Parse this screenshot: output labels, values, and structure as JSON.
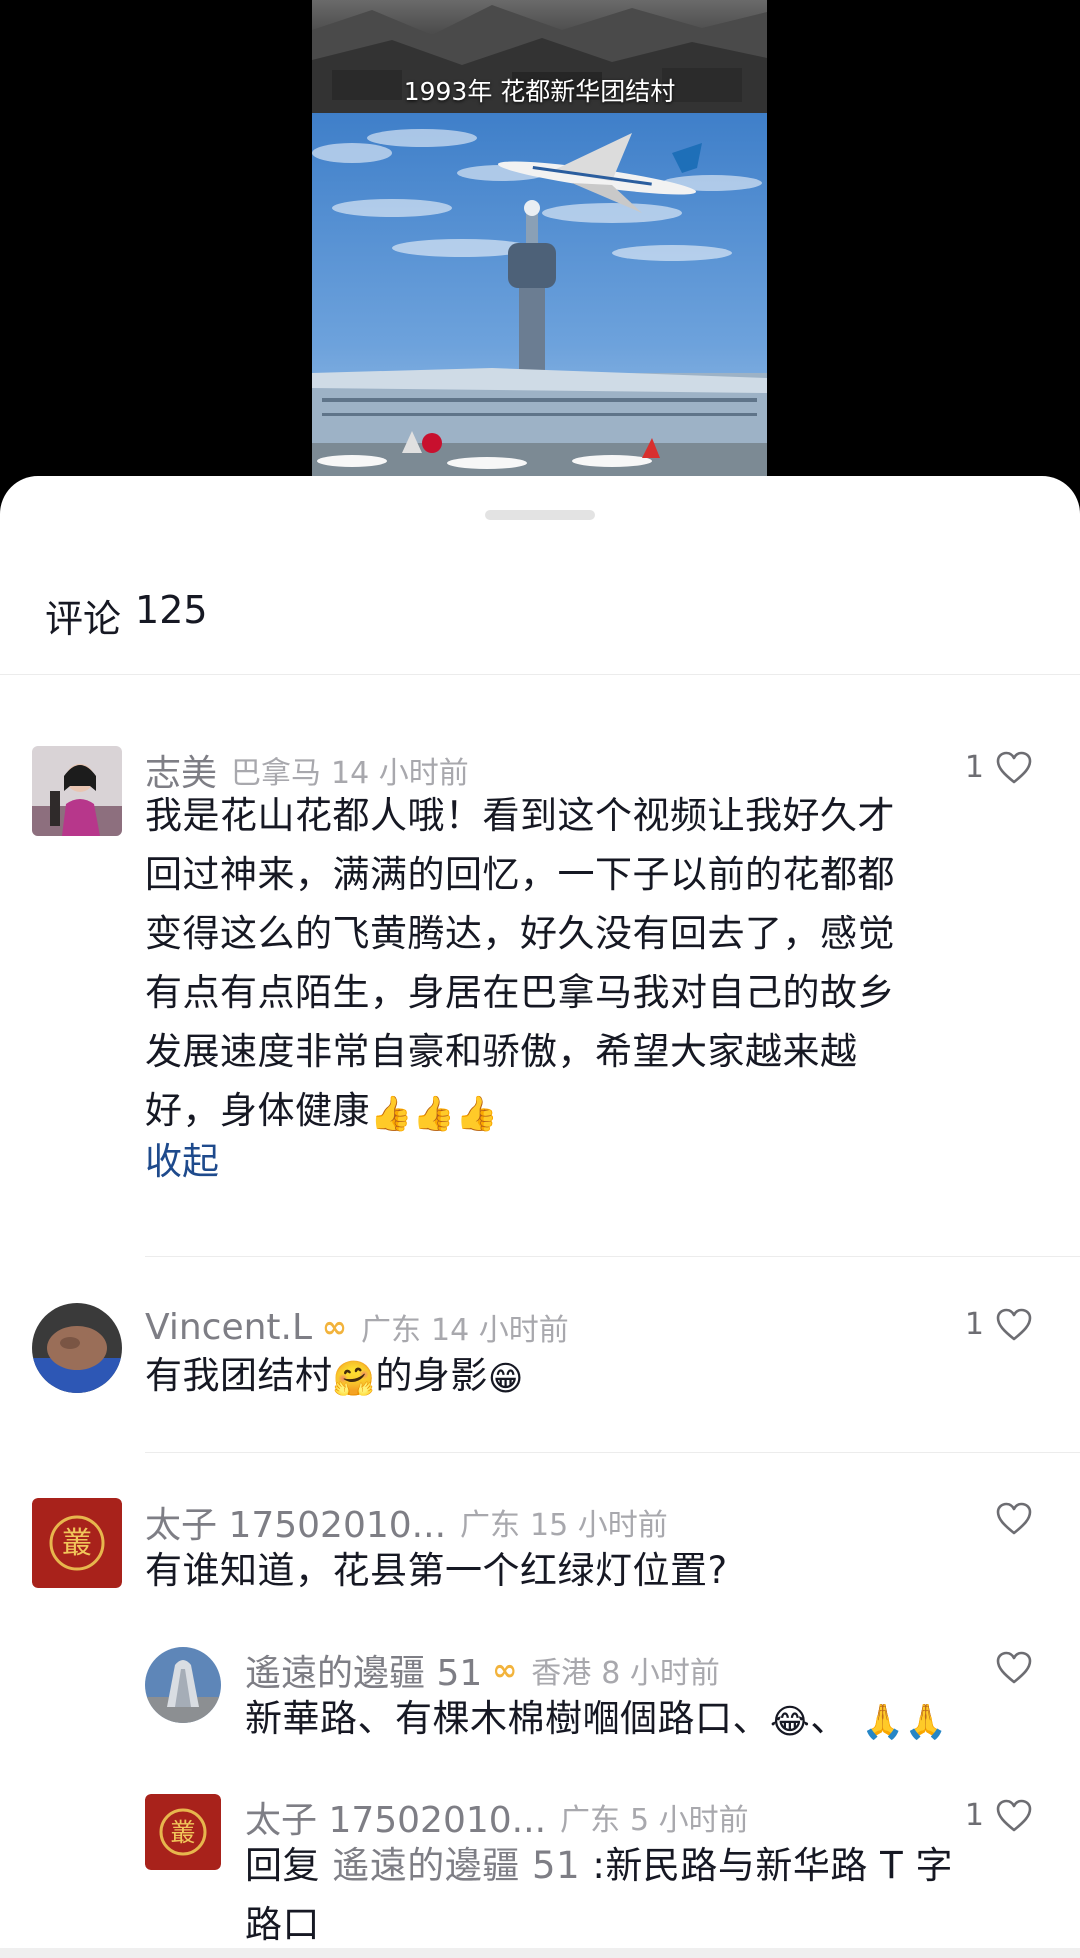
{
  "video": {
    "caption": "1993年 花都新华团结村"
  },
  "comments_panel": {
    "title": "评论",
    "count": "125"
  },
  "comments": [
    {
      "username": "志美",
      "region": "巴拿马",
      "time": "14 小时前",
      "likes": "1",
      "lines": [
        "我是花山花都人哦！看到这个视频让我好久才",
        "回过神来，满满的回忆，一下子以前的花都都",
        "变得这么的飞黄腾达，好久没有回去了，感觉",
        "有点有点陌生，身居在巴拿马我对自己的故乡",
        "发展速度非常自豪和骄傲，希望大家越来越",
        "好，身体健康"
      ],
      "collapse_label": "收起"
    },
    {
      "username": "Vincent.L",
      "region": "广东",
      "time": "14 小时前",
      "likes": "1",
      "text_a": "有我团结村",
      "text_b": "的身影"
    },
    {
      "username": "太子 17502010...",
      "region": "广东",
      "time": "15 小时前",
      "likes": "",
      "text": "有谁知道，花县第一个红绿灯位置?"
    }
  ],
  "replies": [
    {
      "username": "遙遠的邊疆 51",
      "region": "香港",
      "time": "8 小时前",
      "likes": "",
      "text": "新華路、有棵木棉樹嗰個路口、",
      "text_tail": "、"
    },
    {
      "username": "太子 17502010...",
      "region": "广东",
      "time": "5 小时前",
      "likes": "1",
      "reply_prefix": "回复",
      "reply_to": "遙遠的邊疆 51",
      "line1": ":新民路与新华路 T 字",
      "line2": "路口"
    }
  ],
  "icons": {
    "like": "heart-outline-icon",
    "badge": "infinity-badge-icon"
  },
  "colors": {
    "link": "#1e4a8c",
    "muted": "#7e7e85",
    "badge": "#f2b33c"
  }
}
